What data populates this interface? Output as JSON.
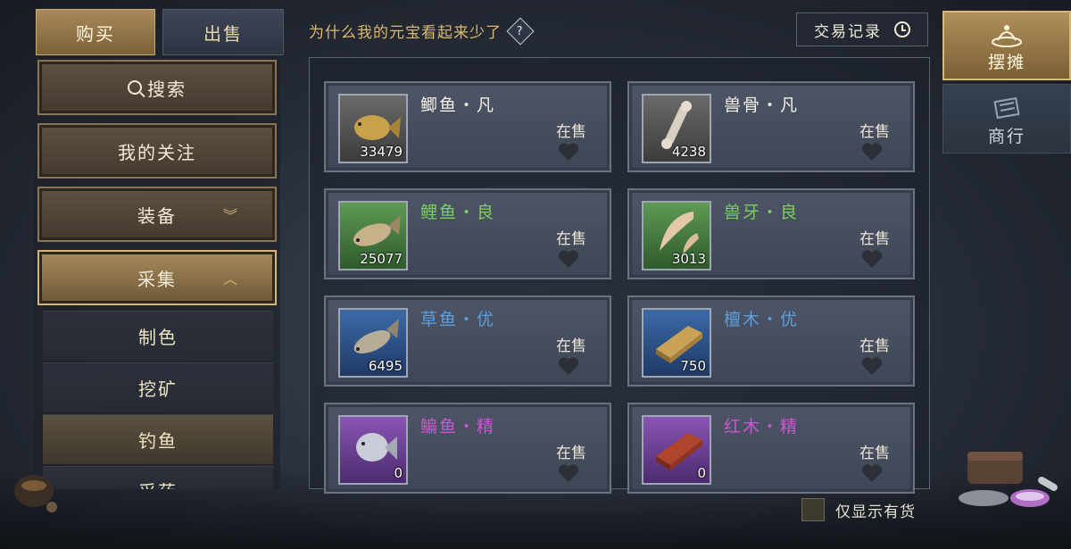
{
  "tabs": {
    "buy": "购买",
    "sell": "出售"
  },
  "left_menu": {
    "search": "搜索",
    "following": "我的关注",
    "equipment": "装备",
    "gathering": "采集",
    "sub_items": [
      "制色",
      "挖矿",
      "钓鱼",
      "采药"
    ]
  },
  "hint": {
    "text": "为什么我的元宝看起来少了",
    "help": "?"
  },
  "trade_record": "交易记录",
  "right_nav": {
    "stall": "摆摊",
    "shop": "商行"
  },
  "stock_filter": "仅显示有货",
  "colors": {
    "fan": "#f3f0e8",
    "liang": "#7ad05b",
    "you": "#5a9fe0",
    "jing": "#d153d4",
    "accent_gold": "#d9b970"
  },
  "items": [
    {
      "name": "鲫鱼・凡",
      "qty": "33479",
      "status": "在售",
      "icon": "crucian-fish-icon"
    },
    {
      "name": "兽骨・凡",
      "qty": "4238",
      "status": "在售",
      "icon": "bone-icon"
    },
    {
      "name": "鲤鱼・良",
      "qty": "25077",
      "status": "在售",
      "icon": "carp-icon"
    },
    {
      "name": "兽牙・良",
      "qty": "3013",
      "status": "在售",
      "icon": "fang-icon"
    },
    {
      "name": "草鱼・优",
      "qty": "6495",
      "status": "在售",
      "icon": "grass-carp-icon"
    },
    {
      "name": "檀木・优",
      "qty": "750",
      "status": "在售",
      "icon": "sandalwood-icon"
    },
    {
      "name": "鳊鱼・精",
      "qty": "0",
      "status": "在售",
      "icon": "bream-icon"
    },
    {
      "name": "红木・精",
      "qty": "0",
      "status": "在售",
      "icon": "redwood-icon"
    }
  ]
}
